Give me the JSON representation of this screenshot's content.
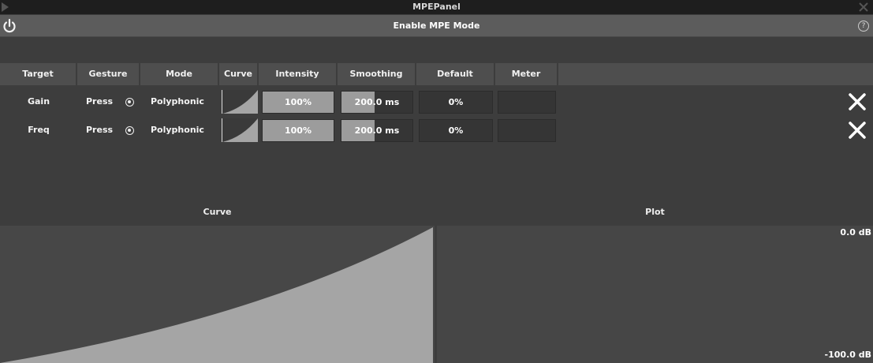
{
  "window": {
    "title": "MPEPanel"
  },
  "enable_bar": {
    "label": "Enable MPE Mode",
    "help": "?"
  },
  "columns": [
    "Target",
    "Gesture",
    "Mode",
    "Curve",
    "Intensity",
    "Smoothing",
    "Default",
    "Meter"
  ],
  "rows": [
    {
      "target": "Gain",
      "gesture": "Press",
      "gesture_selected": true,
      "mode": "Polyphonic",
      "intensity": "100%",
      "intensity_fraction": 1.0,
      "smoothing": "200.0 ms",
      "smoothing_fraction": 0.47,
      "default": "0%"
    },
    {
      "target": "Freq",
      "gesture": "Press",
      "gesture_selected": true,
      "mode": "Polyphonic",
      "intensity": "100%",
      "intensity_fraction": 1.0,
      "smoothing": "200.0 ms",
      "smoothing_fraction": 0.47,
      "default": "0%"
    }
  ],
  "sections": {
    "curve_title": "Curve",
    "plot_title": "Plot"
  },
  "plot": {
    "top_label": "0.0 dB",
    "bottom_label": "-100.0 dB"
  },
  "colors": {
    "background": "#3d3d3d",
    "header": "#4e4e4e",
    "fill": "#9c9c9c",
    "curve_fill": "#a5a5a5"
  }
}
